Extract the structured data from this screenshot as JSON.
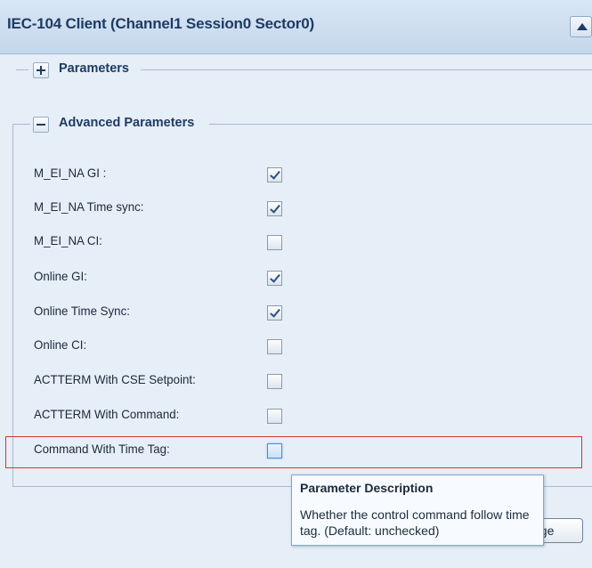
{
  "header": {
    "title": "IEC-104 Client (Channel1 Session0 Sector0)",
    "collapse_icon": "triangle-up-icon"
  },
  "sections": {
    "parameters": {
      "title": "Parameters",
      "toggle_icon": "plus-icon",
      "expanded": false
    },
    "advanced": {
      "title": "Advanced Parameters",
      "toggle_icon": "minus-icon",
      "expanded": true
    }
  },
  "advanced_rows": [
    {
      "label": "M_EI_NA GI :",
      "checked": true
    },
    {
      "label": "M_EI_NA Time sync:",
      "checked": true
    },
    {
      "label": "M_EI_NA CI:",
      "checked": false
    },
    {
      "label": "Online GI:",
      "checked": true
    },
    {
      "label": "Online Time Sync:",
      "checked": true
    },
    {
      "label": "Online CI:",
      "checked": false
    },
    {
      "label": "ACTTERM With CSE Setpoint:",
      "checked": false
    },
    {
      "label": "ACTTERM With Command:",
      "checked": false
    },
    {
      "label": "Command With Time Tag:",
      "checked": false
    }
  ],
  "tooltip": {
    "title": "Parameter Description",
    "body": "Whether the control command follow time tag. (Default: unchecked)"
  },
  "apply_button": {
    "visible_text": "nge"
  },
  "colors": {
    "highlight": "#e03030",
    "accent": "#1f3b63"
  }
}
